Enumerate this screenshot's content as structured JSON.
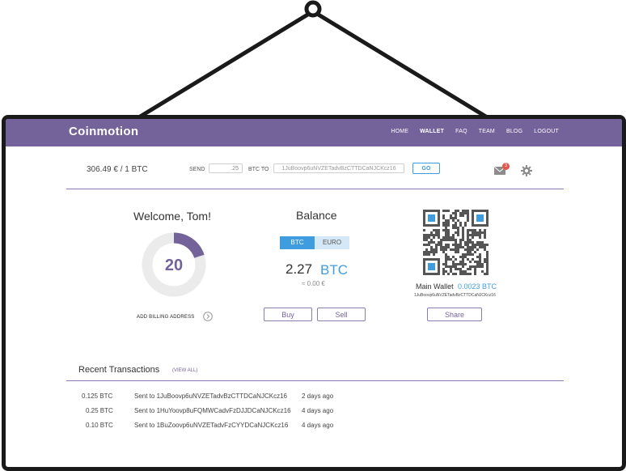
{
  "nav": {
    "logo": "Coinmotion",
    "links": [
      "HOME",
      "WALLET",
      "FAQ",
      "TEAM",
      "BLOG",
      "LOGOUT"
    ],
    "active": "WALLET"
  },
  "topbar": {
    "price": "306.49 € / 1 BTC",
    "send_label": "SEND",
    "send_amount": ".25",
    "btc_to_label": "BTC TO",
    "address": "1JuBoovp6uNVZETadvBzCTTDCaNJCKcz16",
    "go_label": "GO",
    "mail_badge": "3",
    "icons": {
      "mail": "mail-icon",
      "settings": "gear-icon"
    }
  },
  "welcome": {
    "greeting": "Welcome, Tom!",
    "score": "20",
    "score_fraction": 0.2,
    "billing_label": "ADD BILLING ADDRESS"
  },
  "balance": {
    "title": "Balance",
    "toggle": [
      "BTC",
      "EURO"
    ],
    "toggle_active": "BTC",
    "amount": "2.27",
    "unit": "BTC",
    "eur": "≈ 0.00 €",
    "buy_label": "Buy",
    "sell_label": "Sell"
  },
  "wallet": {
    "label": "Main Wallet",
    "value": "0.0023 BTC",
    "address": "1JuBoovp6uNVZETadvBzCTTDCaNJCKcz16",
    "share_label": "Share"
  },
  "transactions": {
    "title": "Recent Transactions",
    "view_all": "(VIEW ALL)",
    "rows": [
      {
        "amount": "0.125 BTC",
        "desc": "Sent to  1JuBoovp6uNVZETadvBzCTTDCaNJCKcz16",
        "when": "2 days ago"
      },
      {
        "amount": "0.25 BTC",
        "desc": "Sent to  1HuYoovp8uFQMWCadvFzDJJDCaNJCKcz16",
        "when": "4 days ago"
      },
      {
        "amount": "0.10 BTC",
        "desc": "Sent to  1BuZoovp6uNVZETadvFzCYYDCaNJCKcz16",
        "when": "4 days ago"
      }
    ]
  },
  "colors": {
    "brand": "#74629a",
    "accent": "#3f9ddf",
    "badge": "#e8534a"
  }
}
